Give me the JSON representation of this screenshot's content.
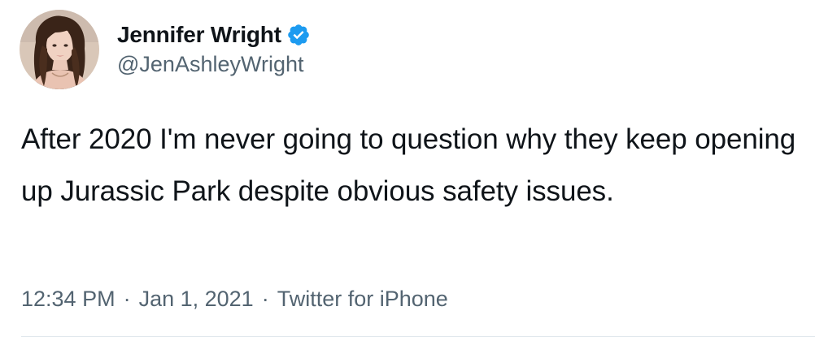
{
  "author": {
    "display_name": "Jennifer Wright",
    "handle": "@JenAshleyWright",
    "verified_color": "#1d9bf0"
  },
  "tweet": {
    "text": "After 2020 I'm never going to question why they keep opening up Jurassic Park despite obvious safety issues.",
    "time": "12:34 PM",
    "date": "Jan 1, 2021",
    "source": "Twitter for iPhone",
    "separator": "·"
  },
  "icons": {
    "verified": "verified-badge-icon",
    "avatar": "profile-photo"
  }
}
